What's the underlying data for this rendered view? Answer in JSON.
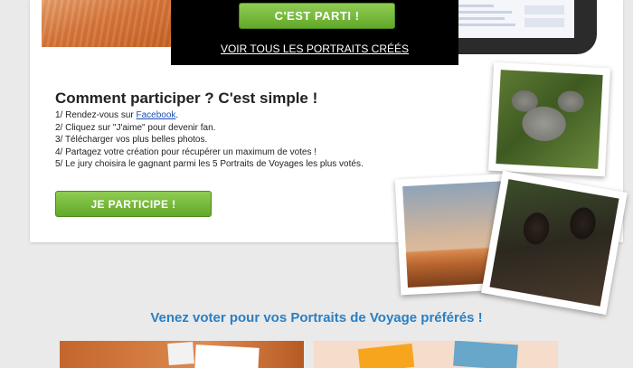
{
  "hero": {
    "start_button": "C'EST PARTI !",
    "see_all_link": "VOIR TOUS LES PORTRAITS CRÉÉS"
  },
  "how_to": {
    "title": "Comment participer ? C'est simple !",
    "steps": [
      {
        "prefix": "1/ Rendez-vous sur ",
        "link": "Facebook",
        "suffix": "."
      },
      {
        "text": "2/ Cliquez sur \"J'aime\" pour devenir fan."
      },
      {
        "text": "3/ Télécharger vos plus belles photos."
      },
      {
        "text": "4/ Partagez votre création pour récupérer un maximum de votes !"
      },
      {
        "text": "5/ Le jury choisira le gagnant parmi les 5 Portraits de Voyages les plus votés."
      }
    ],
    "join_button": "JE PARTICIPE !"
  },
  "vote": {
    "title": "Venez voter pour vos Portraits de Voyage préférés !"
  },
  "colors": {
    "accent_green": "#6db33a",
    "title_blue": "#2a7fc3",
    "link_blue": "#1a4fb4"
  }
}
